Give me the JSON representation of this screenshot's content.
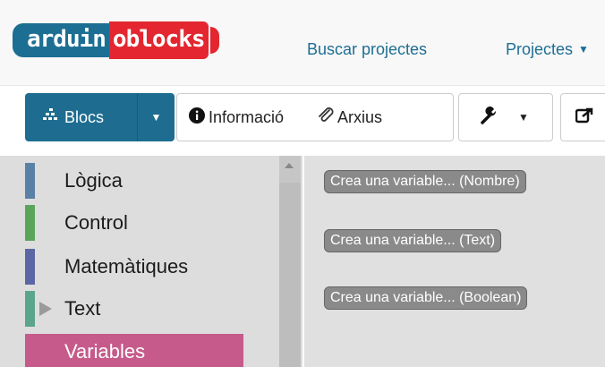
{
  "logo": {
    "part_a": "arduin",
    "part_b": "oblocks"
  },
  "nav": {
    "search_projects": "Buscar projectes",
    "projects": "Projectes"
  },
  "toolbar": {
    "blocks_label": "Blocs",
    "info_label": "Informació",
    "files_label": "Arxius"
  },
  "toolbox": {
    "categories": [
      {
        "label": "Lògica",
        "color": "#5b80a5",
        "selected": false
      },
      {
        "label": "Control",
        "color": "#5ba55b",
        "selected": false
      },
      {
        "label": "Matemàtiques",
        "color": "#5b67a5",
        "selected": false
      },
      {
        "label": "Text",
        "color": "#5ba58c",
        "selected": false
      },
      {
        "label": "Variables",
        "color": "#a55b80",
        "selected": true
      }
    ]
  },
  "flyout": {
    "buttons": [
      "Crea una variable... (Nombre)",
      "Crea una variable... (Text)",
      "Crea una variable... (Boolean)"
    ]
  },
  "icons": {
    "blocks": "blocks-grid-icon",
    "info": "info-circle-icon",
    "files": "paperclip-icon",
    "tools": "wrench-icon",
    "share": "share-icon",
    "caret": "caret-down-icon"
  }
}
